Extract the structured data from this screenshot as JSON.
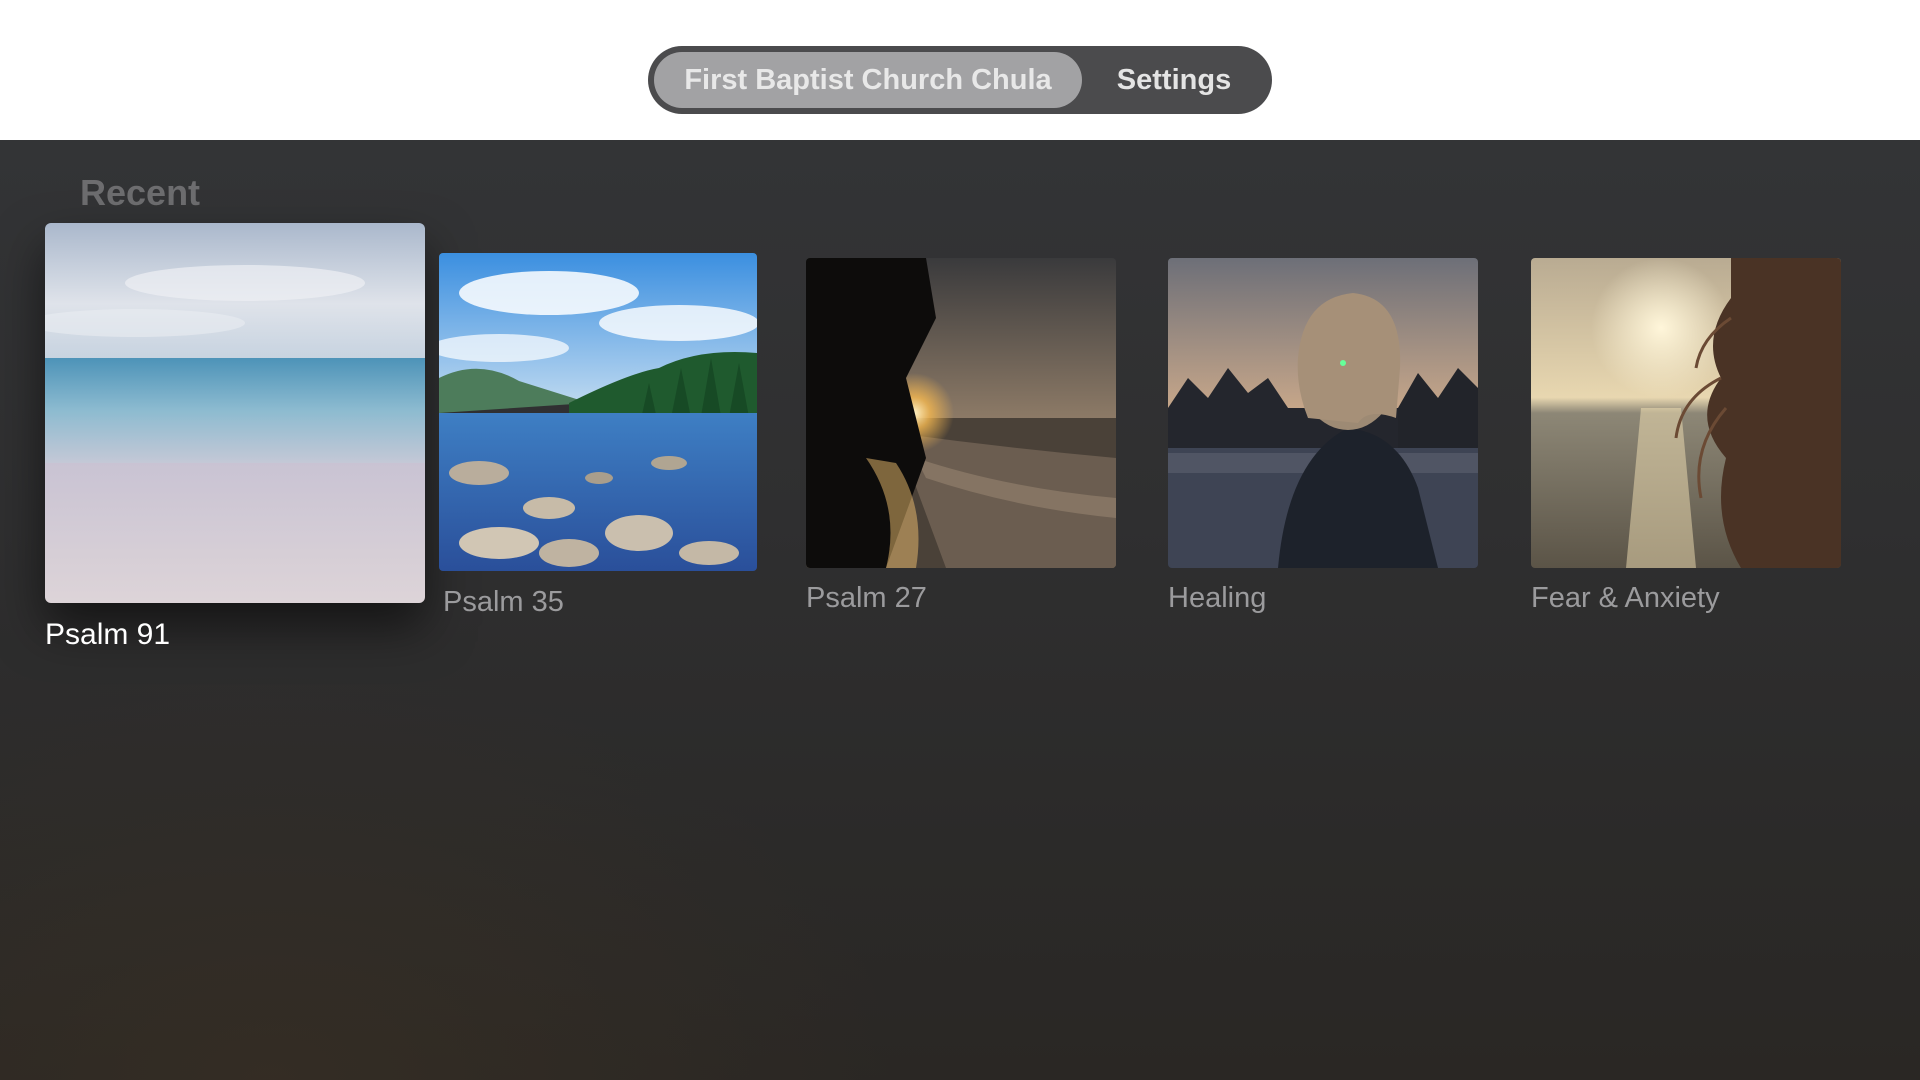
{
  "nav": {
    "tabs": [
      {
        "label": "First Baptist Church Chula",
        "selected": true
      },
      {
        "label": "Settings",
        "selected": false
      }
    ]
  },
  "recent": {
    "title": "Recent",
    "items": [
      {
        "label": "Psalm 91",
        "image": "calm-beach-ocean",
        "focused": true
      },
      {
        "label": "Psalm 35",
        "image": "lake-rocks-forest",
        "focused": false
      },
      {
        "label": "Psalm 27",
        "image": "sunset-shore-trees",
        "focused": false
      },
      {
        "label": "Healing",
        "image": "woman-lake-sunset",
        "focused": false
      },
      {
        "label": "Fear & Anxiety",
        "image": "hair-sea-sunlight",
        "focused": false
      }
    ]
  },
  "colors": {
    "tabbar_bg": "#4b4b4d",
    "tab_selected_bg": "#a2a2a4",
    "content_bg": "#303031",
    "label_color": "#9b9b9d",
    "focused_label_color": "#ffffff"
  }
}
